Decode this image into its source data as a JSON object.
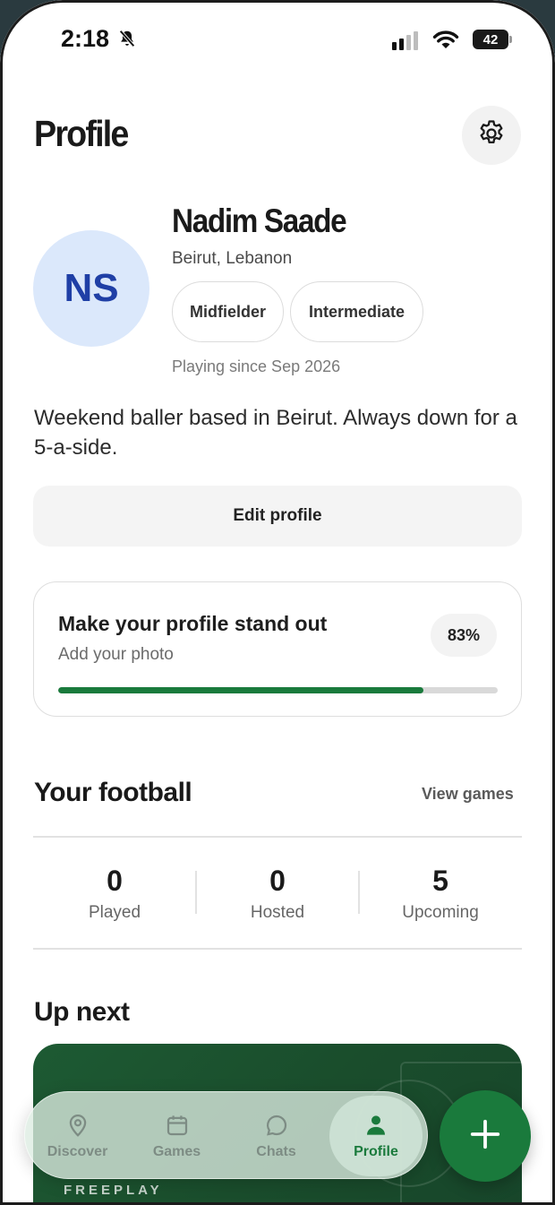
{
  "status_bar": {
    "time": "2:18",
    "battery": "42",
    "icons": [
      "bell-off-icon",
      "signal-icon",
      "wifi-icon",
      "battery-icon"
    ]
  },
  "header": {
    "title": "Profile",
    "settings_icon": "gear-icon"
  },
  "profile": {
    "initials": "NS",
    "name": "Nadim Saade",
    "location": "Beirut, Lebanon",
    "tags": [
      "Midfielder",
      "Intermediate"
    ],
    "playing_since": "Playing since Sep 2026",
    "bio": "Weekend baller based in Beirut. Always down for a 5-a-side.",
    "edit_label": "Edit profile"
  },
  "completion": {
    "title": "Make your profile stand out",
    "subtitle": "Add your photo",
    "percent_label": "83%",
    "progress": 0.83
  },
  "football": {
    "title": "Your football",
    "view_games": "View games",
    "stats": [
      {
        "value": "0",
        "label": "Played"
      },
      {
        "value": "0",
        "label": "Hosted"
      },
      {
        "value": "5",
        "label": "Upcoming"
      }
    ]
  },
  "up_next": {
    "title": "Up next",
    "card_brand": "FREEPLAY"
  },
  "nav": {
    "items": [
      {
        "label": "Discover",
        "icon": "location-pin-icon"
      },
      {
        "label": "Games",
        "icon": "calendar-icon"
      },
      {
        "label": "Chats",
        "icon": "chat-bubble-icon"
      },
      {
        "label": "Profile",
        "icon": "person-icon"
      }
    ],
    "active": "Profile",
    "fab_icon": "plus-icon"
  },
  "colors": {
    "accent_green": "#1a7a3c",
    "avatar_bg": "#dbe8fb",
    "avatar_text": "#1f3fa6"
  }
}
